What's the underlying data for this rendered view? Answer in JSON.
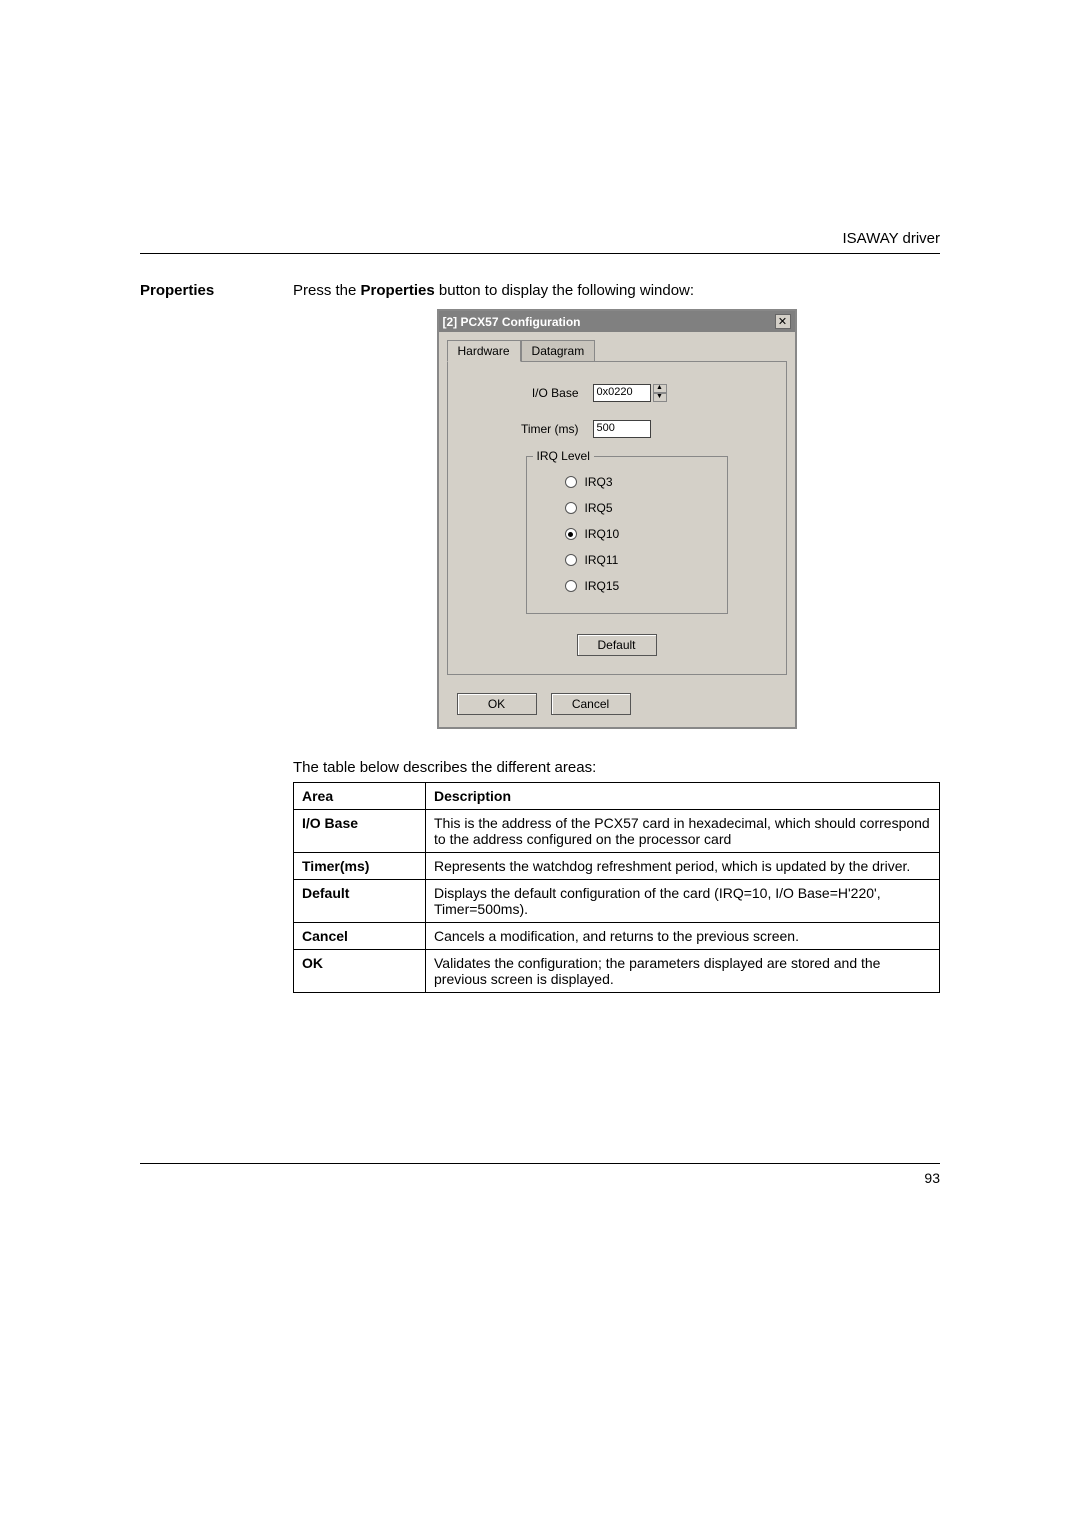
{
  "header": {
    "right": "ISAWAY driver"
  },
  "left_col": {
    "heading": "Properties"
  },
  "intro": {
    "prefix": "Press the ",
    "bold": "Properties",
    "suffix": " button to display the following window:"
  },
  "dialog": {
    "title": "[2] PCX57 Configuration",
    "close_glyph": "✕",
    "tabs": {
      "active": "Hardware",
      "inactive": "Datagram"
    },
    "io_base_label": "I/O Base",
    "io_base_value": "0x0220",
    "timer_label": "Timer (ms)",
    "timer_value": "500",
    "irq_legend": "IRQ Level",
    "irq_options": [
      {
        "label": "IRQ3",
        "selected": false
      },
      {
        "label": "IRQ5",
        "selected": false
      },
      {
        "label": "IRQ10",
        "selected": true
      },
      {
        "label": "IRQ11",
        "selected": false
      },
      {
        "label": "IRQ15",
        "selected": false
      }
    ],
    "default_label": "Default",
    "ok_label": "OK",
    "cancel_label": "Cancel"
  },
  "table": {
    "intro": "The table below describes the different areas:",
    "head_area": "Area",
    "head_desc": "Description",
    "rows": [
      {
        "area": "I/O Base",
        "desc": "This is the address of the PCX57 card in hexadecimal, which should correspond to the address configured on the processor card"
      },
      {
        "area": "Timer(ms)",
        "desc": "Represents the watchdog refreshment period, which is updated by the driver."
      },
      {
        "area": "Default",
        "desc": "Displays the default configuration of the card (IRQ=10, I/O Base=H'220', Timer=500ms)."
      },
      {
        "area": "Cancel",
        "desc": "Cancels a modification, and returns to the previous screen."
      },
      {
        "area": "OK",
        "desc": "Validates the configuration; the parameters displayed are stored and the previous screen is displayed."
      }
    ]
  },
  "footer": {
    "page": "93"
  }
}
